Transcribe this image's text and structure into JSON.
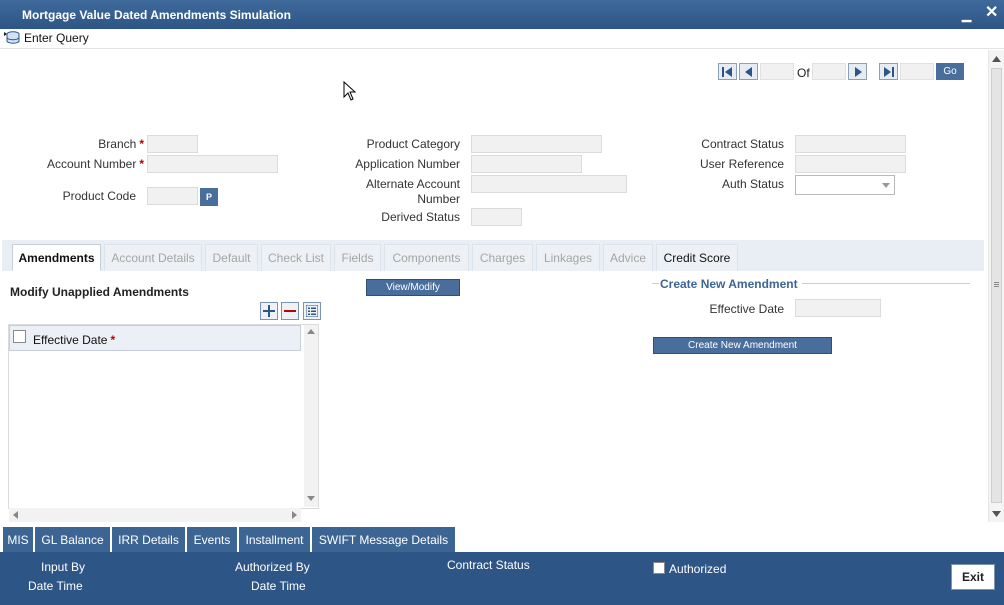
{
  "window": {
    "title": "Mortgage Value Dated Amendments Simulation",
    "minimize_label": "▁",
    "close_label": "✕"
  },
  "toolbar": {
    "enter_query_label": "Enter Query"
  },
  "navigator": {
    "of_label": "Of",
    "go_label": "Go"
  },
  "form": {
    "branch_label": "Branch",
    "account_number_label": "Account Number",
    "product_code_label": "Product Code",
    "product_code_button": "P",
    "product_category_label": "Product Category",
    "application_number_label": "Application Number",
    "alternate_account_label_1": "Alternate Account",
    "alternate_account_label_2": "Number",
    "derived_status_label": "Derived Status",
    "contract_status_label": "Contract Status",
    "user_reference_label": "User Reference",
    "auth_status_label": "Auth Status",
    "required_marker": "*"
  },
  "tabs": [
    {
      "label": "Amendments"
    },
    {
      "label": "Account Details"
    },
    {
      "label": "Default"
    },
    {
      "label": "Check List"
    },
    {
      "label": "Fields"
    },
    {
      "label": "Components"
    },
    {
      "label": "Charges"
    },
    {
      "label": "Linkages"
    },
    {
      "label": "Advice"
    },
    {
      "label": "Credit Score"
    }
  ],
  "amendments": {
    "modify_title": "Modify Unapplied Amendments",
    "grid_column": "Effective Date",
    "view_modify_label": "View/Modify",
    "create_title": "Create New Amendment",
    "effective_date_label": "Effective Date",
    "create_button_label": "Create New Amendment"
  },
  "bottom_tabs": [
    {
      "label": "MIS"
    },
    {
      "label": "GL Balance"
    },
    {
      "label": "IRR Details"
    },
    {
      "label": "Events"
    },
    {
      "label": "Installment"
    },
    {
      "label": "SWIFT Message Details"
    }
  ],
  "footer": {
    "input_by": "Input By",
    "date_time_1": "Date Time",
    "authorized_by": "Authorized By",
    "date_time_2": "Date Time",
    "contract_status": "Contract Status",
    "authorized": "Authorized",
    "exit_label": "Exit"
  },
  "colors": {
    "titlebar": "#2d5585",
    "button_blue": "#4a6e9c",
    "required": "#b00000"
  }
}
